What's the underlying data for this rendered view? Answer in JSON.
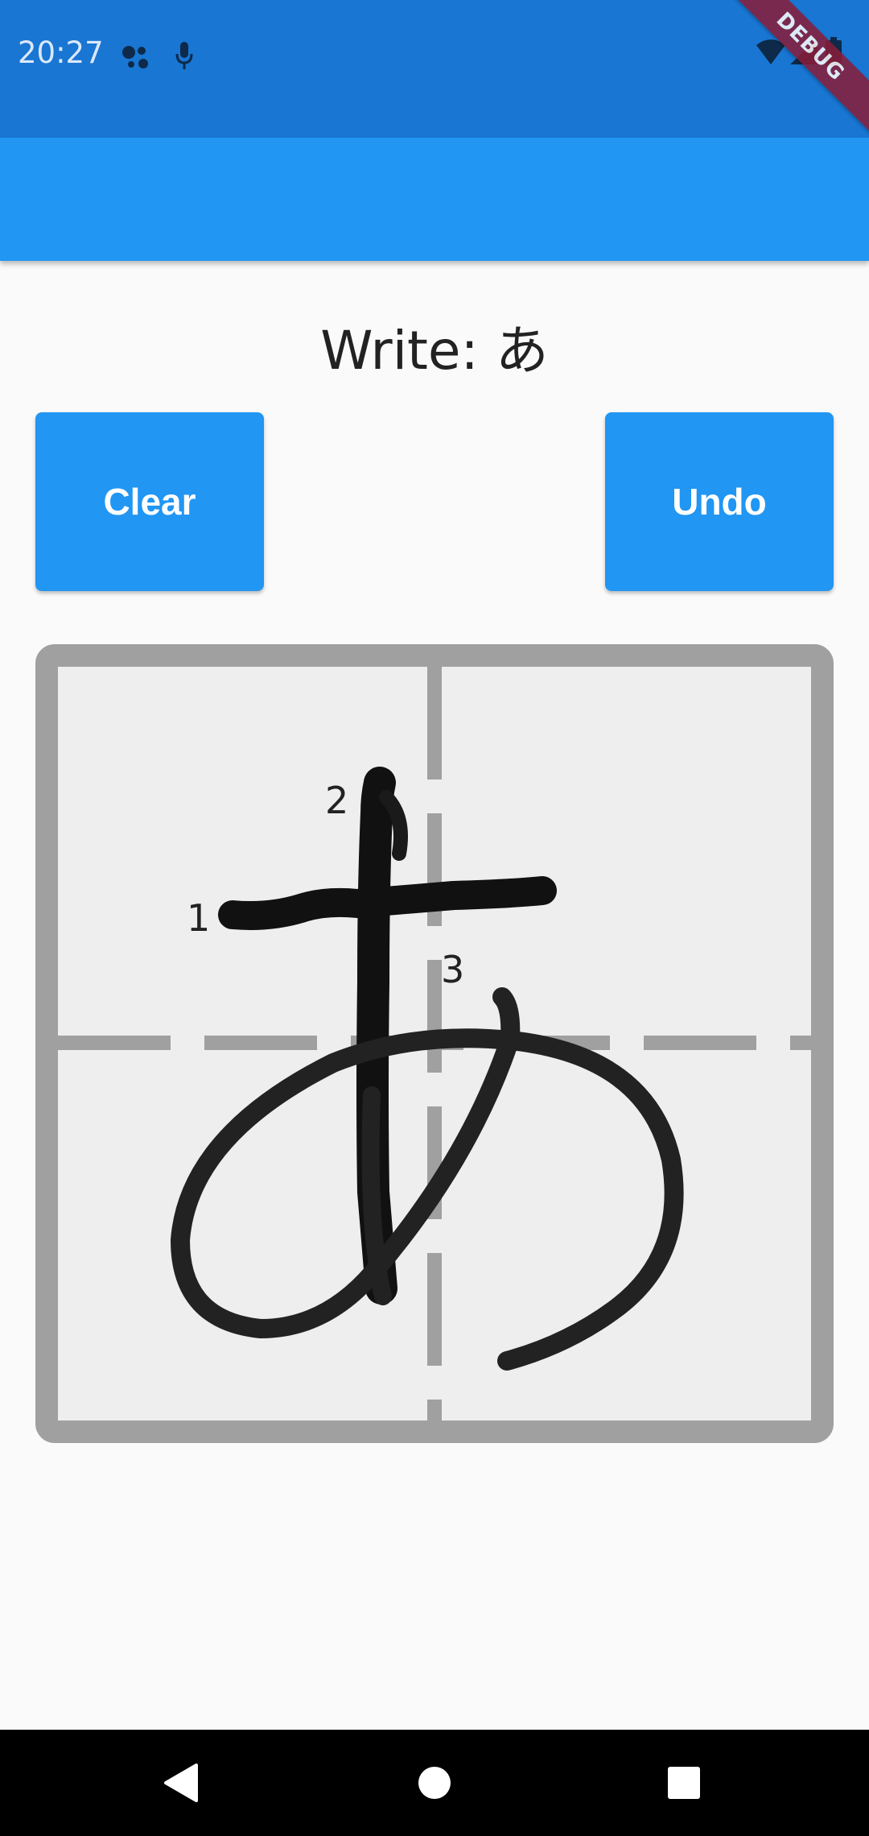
{
  "status_bar": {
    "time": "20:27",
    "icons_left": [
      "assistant-icon",
      "mic-icon"
    ],
    "icons_right": [
      "wifi-icon",
      "signal-icon",
      "battery-icon"
    ],
    "debug_banner": "DEBUG",
    "background_color": "#1976d2"
  },
  "app_bar": {
    "background_color": "#2196f3"
  },
  "main": {
    "prompt": "Write: あ"
  },
  "buttons": {
    "clear_label": "Clear",
    "undo_label": "Undo",
    "color": "#2196f3"
  },
  "canvas": {
    "stroke_numbers": [
      "1",
      "2",
      "3"
    ],
    "grid_color": "#9e9e9e",
    "background_color": "#eeeeee",
    "ink_color": "#111111"
  },
  "nav_bar": {
    "icons": [
      "back-icon",
      "home-icon",
      "recents-icon"
    ]
  }
}
